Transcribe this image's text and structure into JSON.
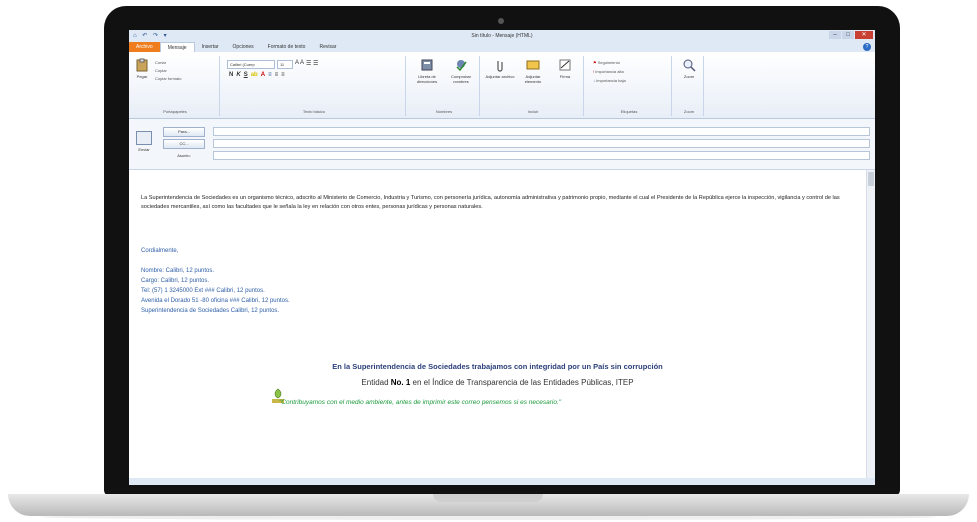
{
  "window": {
    "title": "Sin título - Mensaje (HTML)",
    "quick_access": "⌂ ↶ ↷ ▾",
    "controls": [
      "–",
      "□",
      "✕"
    ]
  },
  "tabs": [
    "Archivo",
    "Mensaje",
    "Insertar",
    "Opciones",
    "Formato de texto",
    "Revisar"
  ],
  "ribbon": {
    "clipboard": {
      "paste": "Pegar",
      "cut": "Cortar",
      "copy": "Copiar",
      "format_painter": "Copiar formato",
      "group": "Portapapeles"
    },
    "basic_text": {
      "font": "Calibri (Cuerp",
      "size": "11",
      "group": "Texto básico"
    },
    "names": {
      "address_book": "Libreta de direcciones",
      "check_names": "Comprobar nombres",
      "group": "Nombres"
    },
    "include": {
      "attach_file": "Adjuntar archivo",
      "attach_item": "Adjuntar elemento",
      "signature": "Firma",
      "group": "Incluir"
    },
    "tags": {
      "follow_up": "Seguimiento",
      "high": "Importancia alta",
      "low": "Importancia baja",
      "group": "Etiquetas"
    },
    "zoom": {
      "zoom": "Zoom",
      "group": "Zoom"
    }
  },
  "header": {
    "send": "Enviar",
    "to": "Para...",
    "cc": "CC...",
    "subject": "Asunto:"
  },
  "body": {
    "paragraph": "La Superintendencia de Sociedades es un organismo técnico, adscrito al Ministerio de Comercio, Industria y Turismo, con personería jurídica, autonomía administrativa y patrimonio propio, mediante el cual el Presidente de la República ejerce la inspección, vigilancia y control de las sociedades mercantiles, así como las facultades que le señala la ley en relación con otros entes, personas jurídicas y personas naturales.",
    "greeting": "Cordialmente,",
    "signature": [
      "Nombre: Calibri, 12 puntos.",
      "Cargo: Calibri, 12 puntos.",
      "Tel: (57) 1 3245000 Ext ### Calibri, 12 puntos.",
      "Avenida el Dorado 51 -80 oficina ### Calibri, 12 puntos.",
      "Superintendencia de Sociedades Calibri, 12 puntos."
    ],
    "slogan1": "En la Superintendencia de Sociedades trabajamos con integridad por un País sin corrupción",
    "slogan2_pre": "Entidad ",
    "slogan2_bold": "No. 1",
    "slogan2_post": " en el Índice de Transparencia de las Entidades Públicas, ITEP",
    "slogan3": "\"Contribuyamos con el medio ambiente, antes de imprimir este correo pensemos si es necesario.\""
  },
  "colors": {
    "file_tab": "#ef7d1e",
    "signature": "#2f5fa7",
    "eco": "#1a9a3b"
  }
}
